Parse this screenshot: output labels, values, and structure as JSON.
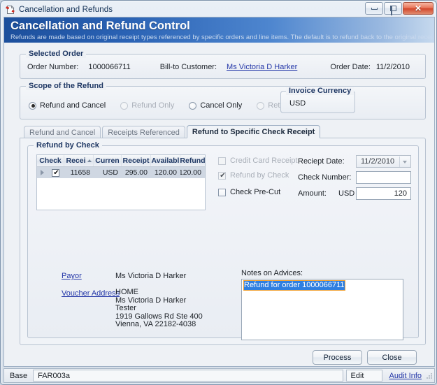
{
  "window": {
    "title": "Cancellation and Refunds",
    "icon": "document-refund-icon",
    "buttons": {
      "minimize": "Minimize",
      "restore": "Restore",
      "close": "Close"
    }
  },
  "banner": {
    "title": "Cancellation and Refund Control",
    "subtitle": "Refunds are made based on original receipt types referenced by specific orders and line items. The default is to refund back to the original receipt ty"
  },
  "selected_order": {
    "group_title": "Selected Order",
    "order_number_label": "Order Number:",
    "order_number_value": "1000066711",
    "bill_to_label": "Bill-to Customer:",
    "bill_to_value": "Ms Victoria D Harker",
    "order_date_label": "Order Date:",
    "order_date_value": "11/2/2010"
  },
  "scope": {
    "group_title": "Scope of the Refund",
    "options": [
      {
        "label": "Refund and Cancel",
        "selected": true,
        "disabled": false
      },
      {
        "label": "Refund Only",
        "selected": false,
        "disabled": true
      },
      {
        "label": "Cancel Only",
        "selected": false,
        "disabled": false
      },
      {
        "label": "Returns",
        "selected": false,
        "disabled": true
      }
    ],
    "currency_group_title": "Invoice Currency",
    "currency_value": "USD"
  },
  "tabs": [
    {
      "label": "Refund and Cancel",
      "active": false
    },
    {
      "label": "Receipts Referenced",
      "active": false
    },
    {
      "label": "Refund to Specific Check Receipt",
      "active": true
    }
  ],
  "refund_by_check": {
    "group_title": "Refund by Check",
    "grid": {
      "columns": [
        "Check",
        "Recei",
        "Curren",
        "Receipt",
        "Availabl",
        "Refund"
      ],
      "sorted_column": "Recei",
      "sort_direction": "ascending",
      "rows": [
        {
          "checked": true,
          "receipt": "11658",
          "currency": "USD",
          "receipt_amount": "295.00",
          "available": "120.00",
          "refund": "120.00",
          "selected": true
        }
      ]
    },
    "checkboxes": [
      {
        "label": "Credit Card Receipt",
        "checked": false,
        "disabled": true
      },
      {
        "label": "Refund by Check",
        "checked": true,
        "disabled": true
      },
      {
        "label": "Check Pre-Cut",
        "checked": false,
        "disabled": false
      }
    ],
    "fields": {
      "receipt_date_label": "Reciept Date:",
      "receipt_date_value": "11/2/2010",
      "check_number_label": "Check Number:",
      "check_number_value": "",
      "amount_label": "Amount:",
      "amount_currency": "USD",
      "amount_value": "120"
    },
    "payor_label": "Payor",
    "payor_value": "Ms Victoria D Harker",
    "voucher_label": "Voucher Address",
    "voucher_value": "HOME\nMs Victoria D Harker\nTester\n1919 Gallows Rd Ste 400\nVienna, VA 22182-4038",
    "notes_label": "Notes on Advices:",
    "notes_value": "Refund for order 1000066711"
  },
  "footer": {
    "process_label": "Process",
    "close_label": "Close"
  },
  "statusbar": {
    "base_label": "Base",
    "form_code": "FAR003a",
    "mode": "Edit",
    "audit_link": "Audit Info"
  },
  "colors": {
    "banner_start": "#1c4f9c",
    "banner_end": "#c6d9ee",
    "link": "#2437a8",
    "selection": "#2f7fe0",
    "group_title": "#1f3864"
  }
}
